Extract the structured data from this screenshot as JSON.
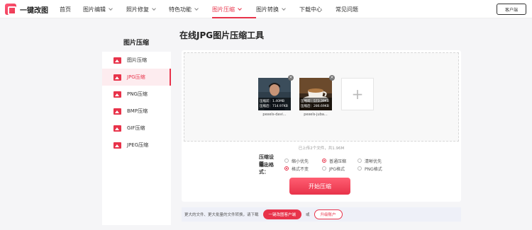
{
  "app": {
    "logo_text": "一键改图"
  },
  "nav": {
    "items": [
      {
        "label": "首页",
        "dropdown": false
      },
      {
        "label": "图片编辑",
        "dropdown": true
      },
      {
        "label": "照片修复",
        "dropdown": true
      },
      {
        "label": "特色功能",
        "dropdown": true
      },
      {
        "label": "图片压缩",
        "dropdown": true,
        "active": true
      },
      {
        "label": "图片转换",
        "dropdown": true
      },
      {
        "label": "下载中心",
        "dropdown": false
      },
      {
        "label": "常见问题",
        "dropdown": false
      }
    ],
    "client_button": "客户端"
  },
  "sidebar": {
    "title": "图片压缩",
    "items": [
      {
        "label": "图片压缩"
      },
      {
        "label": "JPG压缩",
        "active": true
      },
      {
        "label": "PNG压缩"
      },
      {
        "label": "BMP压缩"
      },
      {
        "label": "GIF压缩"
      },
      {
        "label": "JPEG压缩"
      }
    ]
  },
  "main": {
    "title": "在线JPG图片压缩工具",
    "files": [
      {
        "name": "pexels-davi...",
        "before": "压缩前：1.40MB",
        "after": "压缩后：714.97KB"
      },
      {
        "name": "pexels-juba...",
        "before": "压缩前：573.39KB",
        "after": "压缩后：286.69KB"
      }
    ],
    "add_symbol": "+",
    "upload_info": "已上传2个文件，共1.96M",
    "compress_settings": {
      "label": "压缩设置：",
      "options": [
        "缩小优先",
        "普通压缩",
        "清晰优先"
      ],
      "selected": "普通压缩"
    },
    "output_format": {
      "label": "输出格式：",
      "options": [
        "格式不变",
        "JPG格式",
        "PNG格式"
      ],
      "selected": "格式不变"
    },
    "start_button": "开始压缩",
    "bottom": {
      "text": "更大的文件、更大批量的文件转换，请下载",
      "download_button": "一键改图客户端",
      "or": "或",
      "upgrade_button": "升级账户"
    }
  },
  "colors": {
    "accent": "#e8334a",
    "background": "#f5f5f7"
  }
}
